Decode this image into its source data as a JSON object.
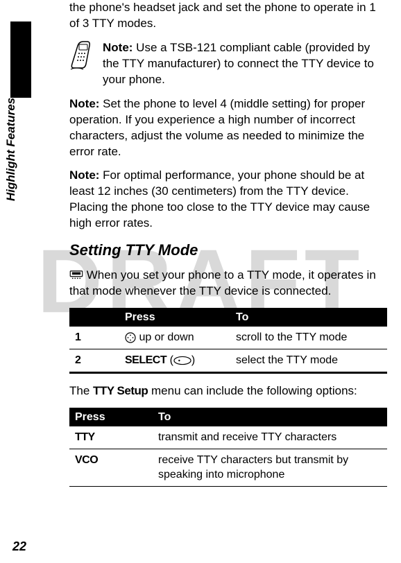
{
  "watermark": "DRAFT",
  "sideLabel": "Highlight Features",
  "pageNumber": "22",
  "para_intro": "the phone's headset jack and set the phone to operate in 1 of 3 TTY modes.",
  "note1_label": "Note:",
  "note1_text": " Use a TSB-121 compliant cable (provided by the TTY manufacturer) to connect the TTY device to your phone.",
  "note2_label": "Note:",
  "note2_text": " Set the phone to level 4 (middle setting) for proper operation. If you experience a high number of incorrect characters, adjust the volume as needed to minimize the error rate.",
  "note3_label": "Note:",
  "note3_text": " For optimal performance, your phone should be at least 12 inches (30 centimeters) from the TTY device. Placing the phone too close to the TTY device may cause high error rates.",
  "heading": "Setting TTY Mode",
  "setting_text": " When you set your phone to a TTY mode, it operates in that mode whenever the TTY device is connected.",
  "table1": {
    "head_blank": "",
    "head_press": "Press",
    "head_to": "To",
    "row1_num": "1",
    "row1_press": " up or down",
    "row1_to": "scroll to the TTY mode",
    "row2_num": "2",
    "row2_press_label": "SELECT",
    "row2_press_paren_open": " (",
    "row2_press_paren_close": ")",
    "row2_to": "select the TTY mode"
  },
  "para_menu_pre": "The ",
  "para_menu_label": "TTY Setup",
  "para_menu_post": " menu can include the following options:",
  "table2": {
    "head_press": "Press",
    "head_to": "To",
    "row1_press": "TTY",
    "row1_to": "transmit and receive TTY characters",
    "row2_press": "VCO",
    "row2_to": "receive TTY characters but transmit by speaking into microphone"
  }
}
